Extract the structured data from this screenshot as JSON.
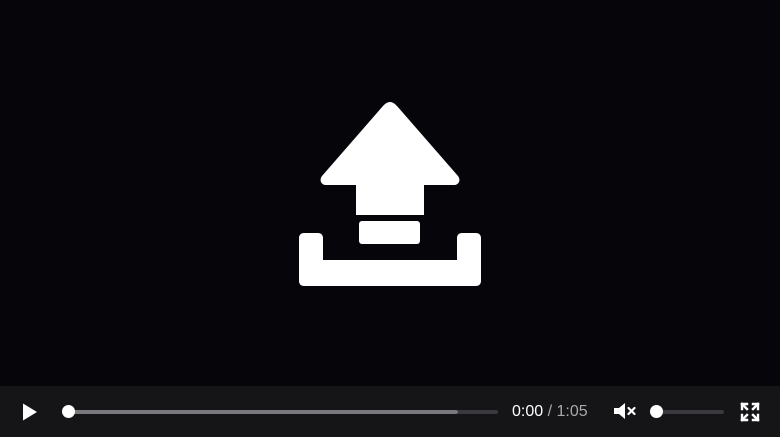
{
  "player": {
    "overlay_icon": "upload-icon",
    "controls": {
      "play_icon": "play-icon",
      "current_time": "0:00",
      "time_separator": "/",
      "duration": "1:05",
      "progress_fraction": 0,
      "mute_icon": "volume-muted-icon",
      "volume_level": 0,
      "fullscreen_icon": "fullscreen-icon"
    }
  },
  "colors": {
    "background": "#06060a",
    "control_bar": "#151518",
    "foreground": "#ffffff",
    "muted_text": "#a9a9ad"
  }
}
